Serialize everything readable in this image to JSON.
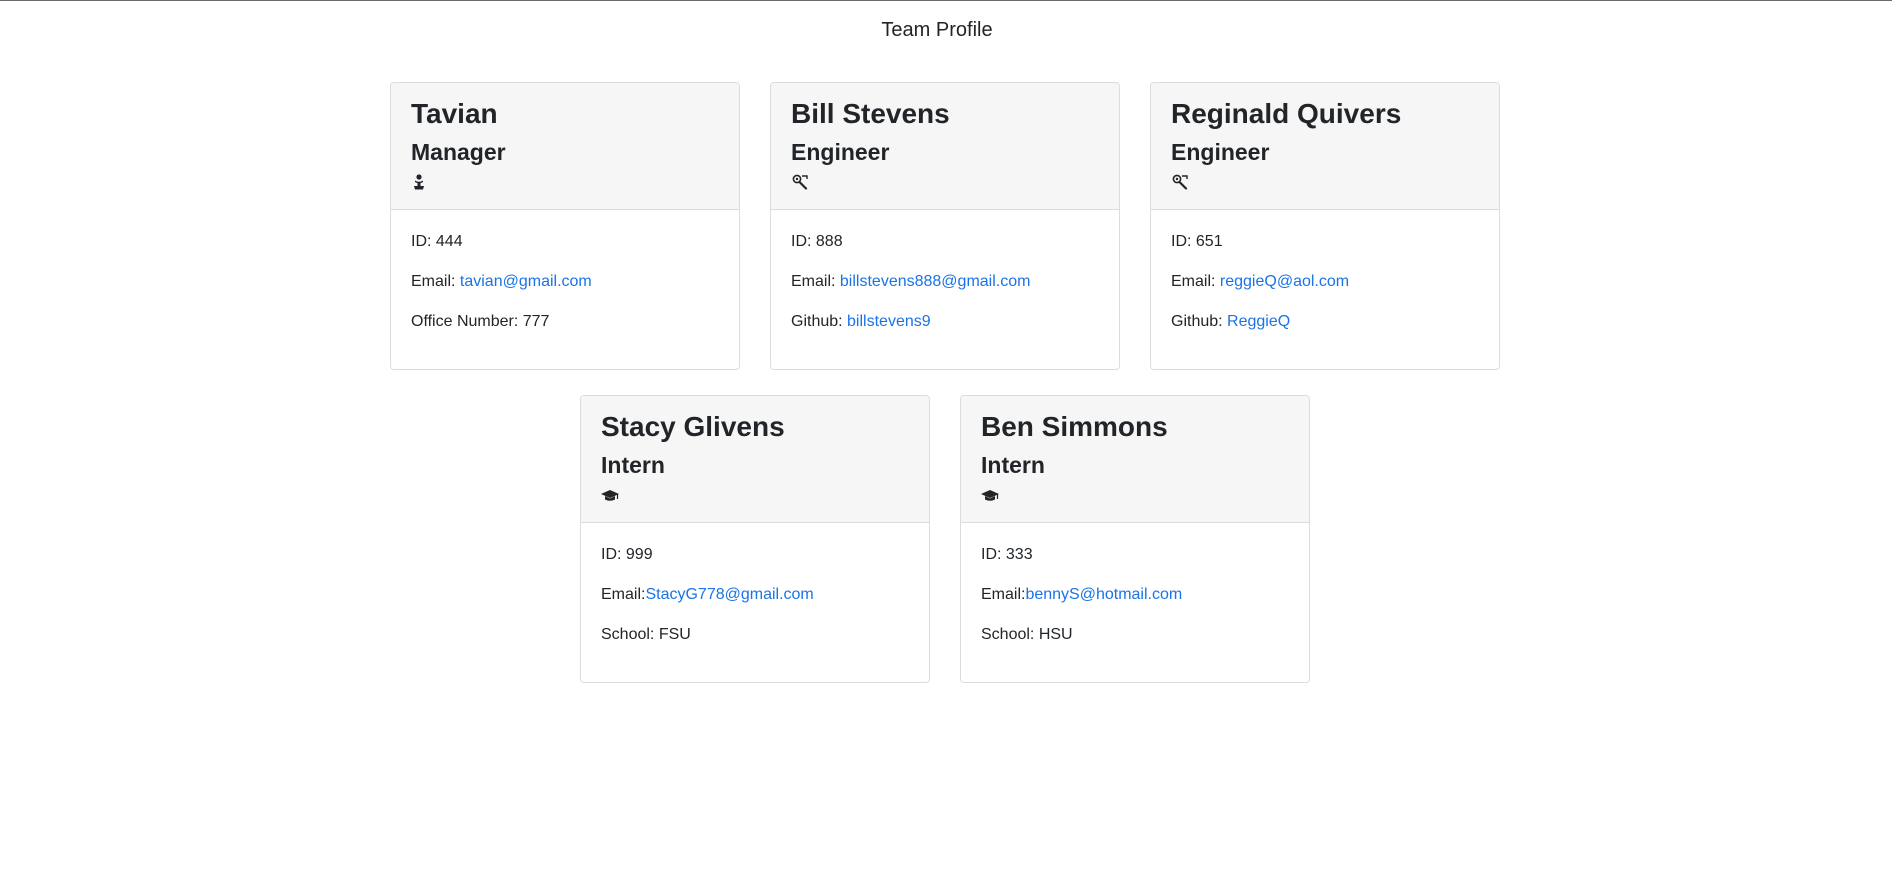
{
  "page_title": "Team Profile",
  "colors": {
    "link": "#1a73e8",
    "text": "#212529",
    "card_header_bg": "#f6f6f6",
    "card_border": "#dcdcdc"
  },
  "cards": [
    {
      "name": "Tavian",
      "role": "Manager",
      "role_icon": "coffee-person-icon",
      "id_label": "ID: 444",
      "email_label": "Email: ",
      "email": "tavian@gmail.com",
      "extra_label": "Office Number: 777",
      "extra_link": ""
    },
    {
      "name": "Bill Stevens",
      "role": "Engineer",
      "role_icon": "wrench-gear-icon",
      "id_label": "ID: 888",
      "email_label": "Email: ",
      "email": "billstevens888@gmail.com",
      "extra_label": "Github: ",
      "extra_link": "billstevens9"
    },
    {
      "name": "Reginald Quivers",
      "role": "Engineer",
      "role_icon": "wrench-gear-icon",
      "id_label": "ID: 651",
      "email_label": "Email: ",
      "email": "reggieQ@aol.com",
      "extra_label": "Github: ",
      "extra_link": "ReggieQ"
    },
    {
      "name": "Stacy Glivens",
      "role": "Intern",
      "role_icon": "graduation-cap-icon",
      "id_label": "ID: 999",
      "email_label": "Email:",
      "email": "StacyG778@gmail.com",
      "extra_label": "School: FSU",
      "extra_link": ""
    },
    {
      "name": "Ben Simmons",
      "role": "Intern",
      "role_icon": "graduation-cap-icon",
      "id_label": "ID: 333",
      "email_label": "Email:",
      "email": "bennyS@hotmail.com",
      "extra_label": "School: HSU",
      "extra_link": ""
    }
  ]
}
